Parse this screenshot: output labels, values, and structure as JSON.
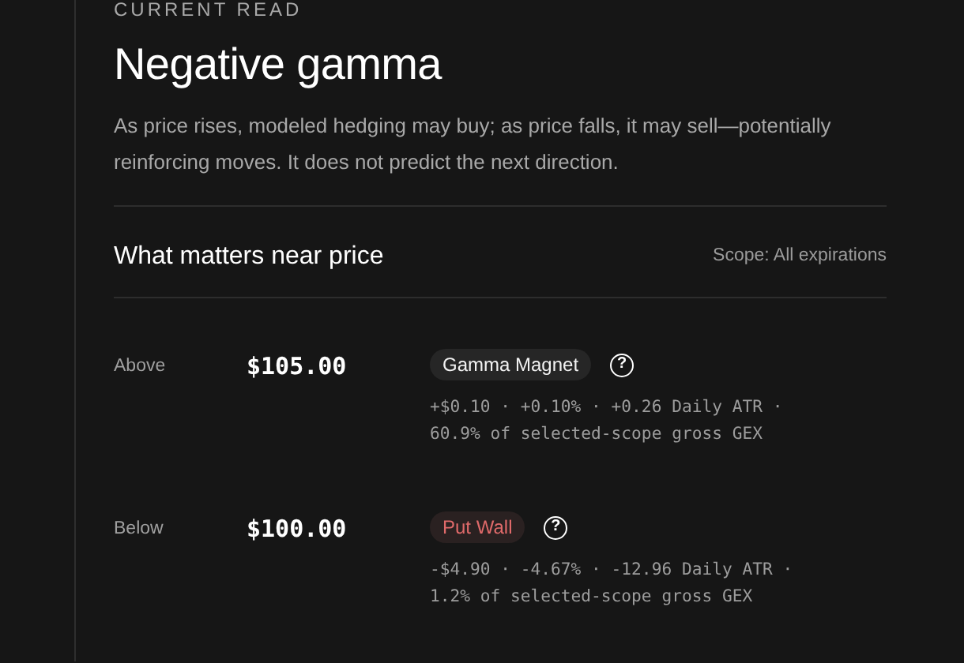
{
  "eyebrow": "CURRENT READ",
  "title": "Negative gamma",
  "description": "As price rises, modeled hedging may buy; as price falls, it may sell—potentially reinforcing moves. It does not predict the next direction.",
  "section": {
    "heading": "What matters near price",
    "scope": "Scope: All expirations",
    "levels": [
      {
        "side": "Above",
        "price": "$105.00",
        "tag": {
          "label": "Gamma Magnet",
          "kind": "neutral"
        },
        "help": "?",
        "details": [
          "+$0.10 · +0.10% · +0.26 Daily ATR ·",
          "60.9% of selected-scope gross GEX"
        ]
      },
      {
        "side": "Below",
        "price": "$100.00",
        "tag": {
          "label": "Put Wall",
          "kind": "bearish"
        },
        "help": "?",
        "details": [
          "-$4.90 · -4.67% · -12.96 Daily ATR ·",
          "1.2% of selected-scope gross GEX"
        ]
      }
    ]
  }
}
